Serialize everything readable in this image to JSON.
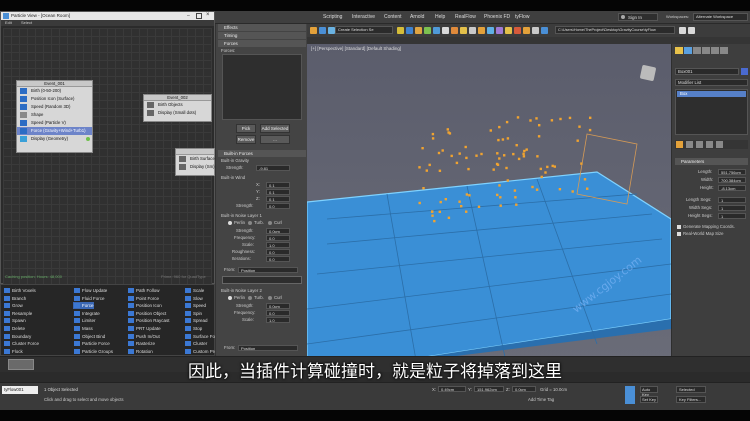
{
  "particle_view": {
    "title": "Particle View - [Ocean Room]",
    "menu": [
      "Edit",
      "Select",
      "Display",
      "Options",
      "Tools"
    ],
    "event1": {
      "title": "Event_001",
      "rows": [
        "Birth (0-50-200)",
        "Position Icon (Surface)",
        "Speed (Random 3D)",
        "Shape",
        "Speed (Particle V)",
        "Force (Gravity+Wind+Turb1)",
        "Display (Geometry)"
      ]
    },
    "event2": {
      "title": "Event_002",
      "rows": [
        "Birth Objects",
        "Display (Small dots)"
      ]
    },
    "event3": {
      "rows": [
        "Birth Surface",
        "Display (Sm)"
      ]
    },
    "status_left": "Caching position: Hours: 48,000",
    "status_right": "Prime: 960 for QuadType",
    "depot": [
      [
        "Birth Voxels",
        "Flow Update",
        "Path Follow",
        "Scale"
      ],
      [
        "Branch",
        "Fluid Force",
        "Point Force",
        "Slow"
      ],
      [
        "Grow",
        "Force",
        "Position Icon",
        "Speed"
      ],
      [
        "Resample",
        "Integrate",
        "Position Object",
        "Spin"
      ],
      [
        "Spawn",
        "Limiter",
        "Position Raycast",
        "Spread"
      ],
      [
        "Delete",
        "Mass",
        "PRT Update",
        "Stop"
      ],
      [
        "Boundary",
        "Object Bind",
        "Push In/Out",
        "Surface Force"
      ],
      [
        "Cluster Force",
        "Particle Force",
        "Rasterize",
        "Cluster"
      ],
      [
        "Flock",
        "Particle Groups",
        "Rotation",
        "Custom Props"
      ]
    ]
  },
  "panel": {
    "effects": "Effects",
    "timing": "Timing",
    "forces": "Forces",
    "forces_list_label": "Forces:",
    "btn_pick": "Pick",
    "btn_add_selected": "Add Selected",
    "btn_remove": "Remove",
    "btn_dots": "...",
    "builtin": "Built-in Forces",
    "builtin_gravity": "Built-in Gravity",
    "strength_label": "Strength:",
    "gravity_strength": "-9.81",
    "builtin_wind": "Built-in Wind",
    "x_label": "X:",
    "y_label": "Y:",
    "z_label": "Z:",
    "wind_x": "0.1",
    "wind_y": "0.1",
    "wind_z": "0.1",
    "wind_strength": "0.0",
    "noise1": "Built-in Noise Layer 1",
    "perlin": "Perlin",
    "turb": "Turb.",
    "curl": "Curl",
    "frequency_label": "Frequency:",
    "scale_label": "Scale:",
    "roughness_label": "Roughness:",
    "iterations_label": "Iterations:",
    "n1_strength": "0.0cm",
    "n1_freq": "0.0",
    "n1_scale": "1.0",
    "n1_rough": "0.0",
    "n1_iter": "0.0",
    "from_label": "From:",
    "from_value": "Position",
    "noise2": "Built-in Noise Layer 2",
    "n2_strength": "0.0cm",
    "n2_freq": "0.0",
    "n2_scale": "1.0",
    "from2_value": "Position"
  },
  "menubar": [
    "Scripting",
    "Interactive",
    "Content",
    "Arnold",
    "Help",
    "RealFlow",
    "Phoenix FD",
    "tyFlow"
  ],
  "sign_in": "Sign In",
  "workspace_label": "Workspaces:",
  "workspace_value": "Alternate Workspace",
  "create_selection": "Create Selection Se",
  "path_value": "C:\\Users\\Home\\TheProject\\Desktop\\GravityCourse\\tyFlow",
  "viewport_label": "[+] [Perspective] [Standard] [Default Shading]",
  "command_panel": {
    "object_name": "Box001",
    "modifier_list": "Modifier List",
    "stack_item": "Box",
    "parameters": "Parameters",
    "length_label": "Length:",
    "length": "551.756cm",
    "width_label": "Width:",
    "width": "700.384cm",
    "height_label": "Height:",
    "height": "-8.13cm",
    "length_segs_label": "Length Segs:",
    "length_segs": "1",
    "width_segs_label": "Width Segs:",
    "width_segs": "1",
    "height_segs_label": "Height Segs:",
    "height_segs": "1",
    "gen_map": "Generate Mapping Coords.",
    "real_world": "Real-World Map Size"
  },
  "status": {
    "left_field": "tyFlow001",
    "selected": "1 Object Selected",
    "hint": "Click and drag to select and move objects",
    "x_label": "X:",
    "x": "0.49cm",
    "y_label": "Y:",
    "y": "151.962cm",
    "z_label": "Z:",
    "z": "0.0cm",
    "grid": "Grid = 10.0cm",
    "add_time_tag": "Add Time Tag",
    "auto_key": "Auto Key",
    "set_key": "Set Key",
    "selected_label": "Selected",
    "key_filters": "Key Filters..."
  },
  "subtitle": "因此，当插件计算碰撞时，就是粒子将掉落到这里",
  "watermark": "www.cgjoy.com"
}
